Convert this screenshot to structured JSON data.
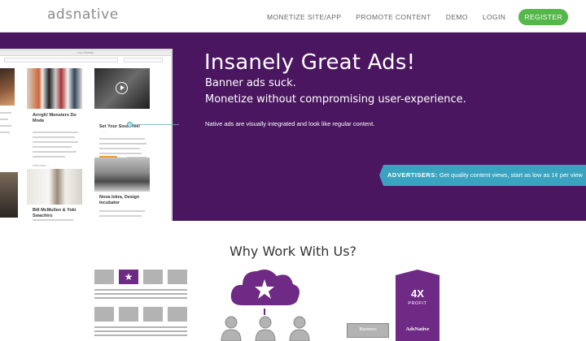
{
  "brand": {
    "logo": "adsnative",
    "accent": "#4a1660",
    "register_color": "#55b64a",
    "banner_color": "#3aa3bf"
  },
  "nav": {
    "links": [
      "MONETIZE SITE/APP",
      "PROMOTE CONTENT",
      "DEMO",
      "LOGIN"
    ],
    "register": "REGISTER"
  },
  "hero": {
    "title": "Insanely Great Ads!",
    "sub1": "Banner ads suck.",
    "sub2": "Monetize without compromising user-experience.",
    "small": "Native ads are visually integrated and look like regular content.",
    "banner_strong": "ADVERTISERS:",
    "banner_text": " Get quality content views, start as low as 1¢ per view"
  },
  "mockup": {
    "window_title": "Your Website",
    "tiles": [
      {
        "title": "Arrrgh! Monsters Do Mode",
        "more": "View more →"
      },
      {
        "title": "Set Your Soul Free!",
        "more": ""
      },
      {
        "title": "Bill McMullen & Yoki Swachiro",
        "more": ""
      },
      {
        "title": "Nova Iskra, Design Incubator",
        "more": ""
      }
    ]
  },
  "why": {
    "title": "Why Work With Us?",
    "banners_label": "Banners",
    "adsnative_label": "AdsNative",
    "profit_multiple": "4X",
    "profit_label": "PROFIT"
  }
}
